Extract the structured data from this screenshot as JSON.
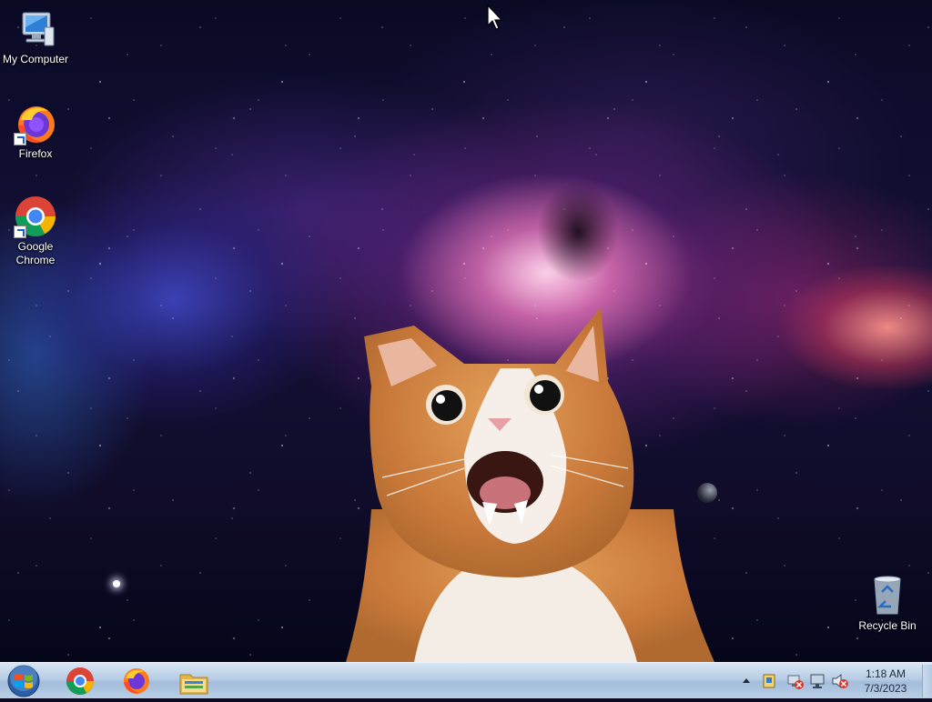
{
  "desktop_icons": [
    {
      "label": "My Computer",
      "icon": "computer-icon"
    },
    {
      "label": "Firefox",
      "icon": "firefox-icon"
    },
    {
      "label": "Google Chrome",
      "icon": "chrome-icon"
    },
    {
      "label": "Recycle Bin",
      "icon": "recycle-bin-icon"
    }
  ],
  "taskbar": {
    "start_icon": "windows-logo-icon",
    "pinned": [
      {
        "name": "Google Chrome",
        "icon": "chrome-icon"
      },
      {
        "name": "Firefox",
        "icon": "firefox-icon"
      },
      {
        "name": "Windows Explorer",
        "icon": "folder-icon"
      }
    ],
    "tray_icons": [
      "show-hidden-icons-arrow",
      "action-center-icon",
      "network-disabled-icon",
      "display-icon",
      "volume-muted-icon"
    ],
    "clock": {
      "time": "1:18 AM",
      "date": "7/3/2023"
    }
  },
  "wallpaper": {
    "subject": "orange-white-cat-in-space",
    "colors": {
      "space_dark": "#0b0a22",
      "nebula_pink": "#d24fa8",
      "nebula_blue": "#4650dc",
      "cat_orange": "#d88a3a"
    }
  }
}
